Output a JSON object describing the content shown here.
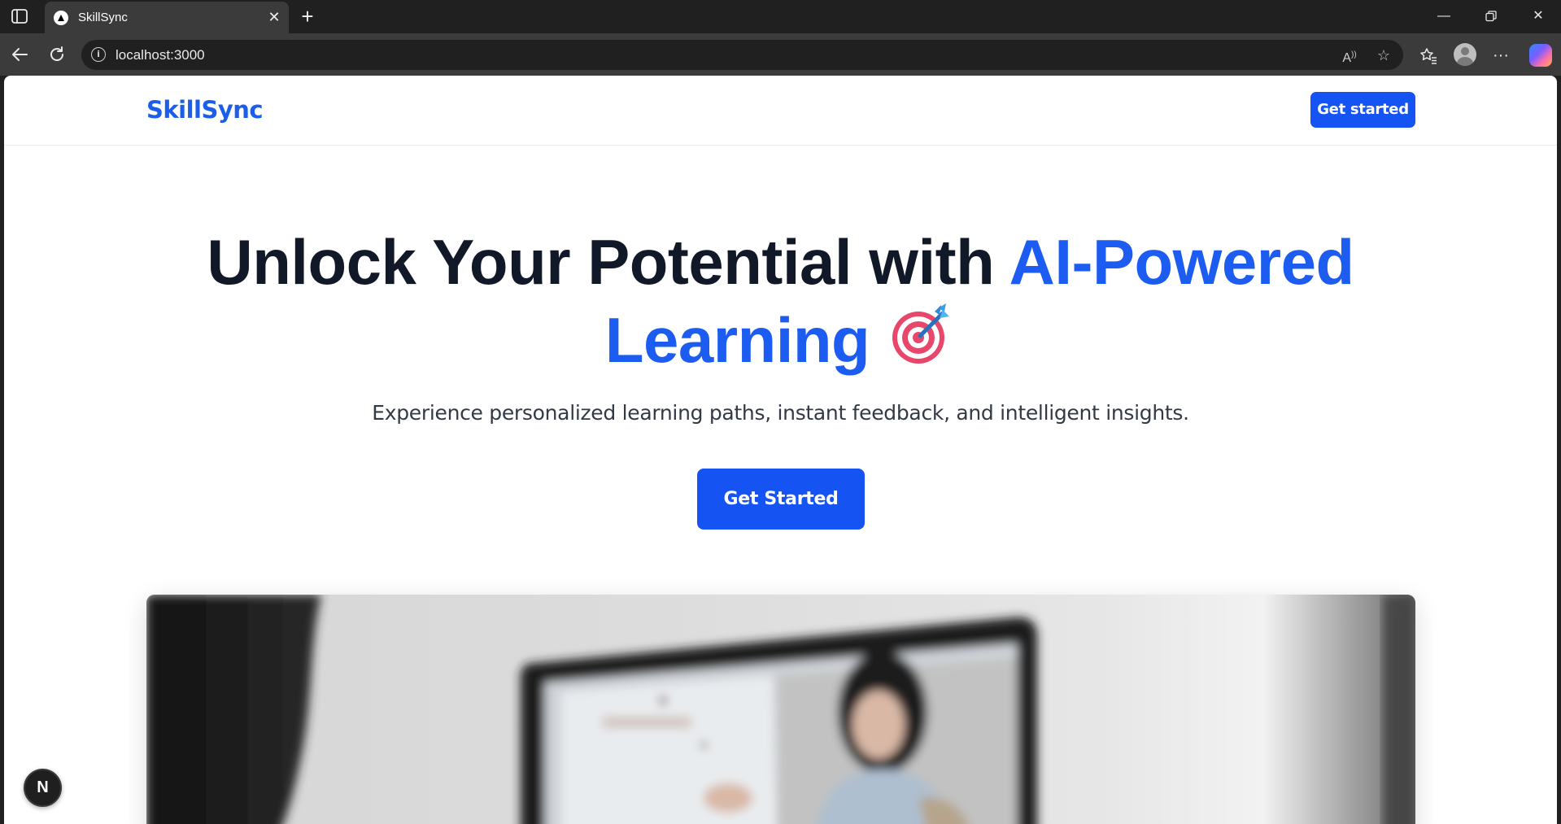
{
  "browser": {
    "tab_title": "SkillSync",
    "url": "localhost:3000",
    "icons": {
      "sidebar": "sidebar-toggle-icon",
      "close_tab": "close-icon",
      "new_tab": "plus-icon",
      "back": "back-arrow-icon",
      "reload": "reload-icon",
      "site_info": "info-icon",
      "read_aloud": "read-aloud-icon",
      "favorite": "star-icon",
      "favorites": "favorites-icon",
      "profile": "profile-icon",
      "more": "more-icon",
      "copilot": "copilot-icon"
    }
  },
  "header": {
    "logo": "SkillSync",
    "cta_label": "Get started"
  },
  "hero": {
    "title_part1": "Unlock Your Potential with ",
    "title_accent_1": "AI-Powered",
    "title_accent_2": "Learning",
    "title_icon": "target-icon",
    "subtitle": "Experience personalized learning paths, instant feedback, and intelligent insights.",
    "cta_label": "Get Started",
    "image": "hero-image"
  },
  "dev_badge": {
    "label": "N"
  },
  "colors": {
    "brand": "#1554f3",
    "accent_text": "#1c5cf0",
    "heading": "#111827",
    "browser_dark": "#202020",
    "browser_toolbar": "#3b3b3b"
  }
}
